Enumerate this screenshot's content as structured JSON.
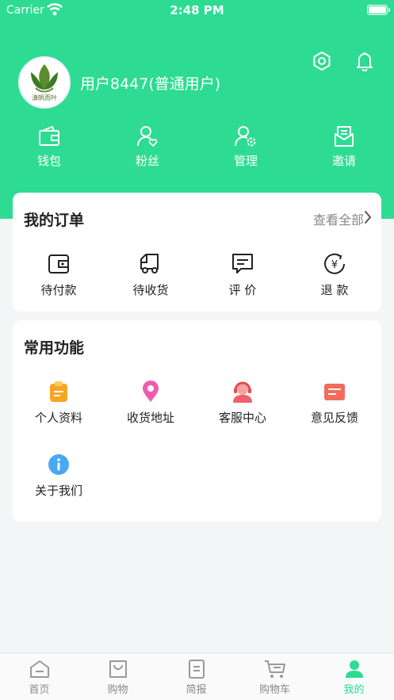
{
  "status_bar": {
    "carrier": "Carrier",
    "time": "2:48 PM"
  },
  "profile": {
    "name": "用户8447(普通用户)",
    "logo_text": "滇帆而叶"
  },
  "header_icons": [
    "settings-icon",
    "bell-icon"
  ],
  "quick_actions": [
    {
      "label": "钱包",
      "icon": "wallet-icon"
    },
    {
      "label": "粉丝",
      "icon": "fans-icon"
    },
    {
      "label": "管理",
      "icon": "manage-icon"
    },
    {
      "label": "邀请",
      "icon": "invite-icon"
    }
  ],
  "orders": {
    "title": "我的订单",
    "view_all": "查看全部",
    "items": [
      {
        "label": "待付款",
        "icon": "wallet-icon"
      },
      {
        "label": "待收货",
        "icon": "truck-icon"
      },
      {
        "label": "评 价",
        "icon": "comment-icon"
      },
      {
        "label": "退 款",
        "icon": "refund-icon"
      }
    ]
  },
  "functions": {
    "title": "常用功能",
    "items": [
      {
        "label": "个人资料",
        "icon": "profile-icon",
        "color": "#f6a623"
      },
      {
        "label": "收货地址",
        "icon": "location-icon",
        "color": "#f05bb2"
      },
      {
        "label": "客服中心",
        "icon": "customer-service-icon",
        "color": "#f0606a"
      },
      {
        "label": "意见反馈",
        "icon": "feedback-icon",
        "color": "#f26b5b"
      },
      {
        "label": "关于我们",
        "icon": "info-icon",
        "color": "#4aa8f2"
      }
    ]
  },
  "tabbar": {
    "items": [
      {
        "label": "首页",
        "icon": "home-icon"
      },
      {
        "label": "购物",
        "icon": "shopping-bag-icon"
      },
      {
        "label": "简报",
        "icon": "report-icon"
      },
      {
        "label": "购物车",
        "icon": "cart-icon"
      },
      {
        "label": "我的",
        "icon": "user-icon"
      }
    ],
    "active": "我的"
  },
  "colors": {
    "brand": "#2ddc92",
    "background": "#f4f5f6"
  }
}
